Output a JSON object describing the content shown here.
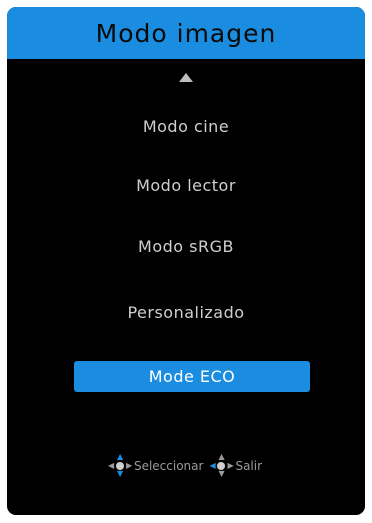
{
  "menu": {
    "title": "Modo imagen",
    "items": [
      {
        "label": "Modo cine"
      },
      {
        "label": "Modo lector"
      },
      {
        "label": "Modo sRGB"
      },
      {
        "label": "Personalizado"
      },
      {
        "label": "Mode ECO"
      }
    ],
    "selected_index": 4
  },
  "hints": {
    "select": "Seleccionar",
    "exit": "Salir"
  },
  "colors": {
    "accent": "#1b8de0",
    "background": "#000000",
    "text": "#cfcfcf"
  },
  "icons": {
    "scroll": "triangle-up-icon",
    "navigate": "joystick-icon"
  }
}
